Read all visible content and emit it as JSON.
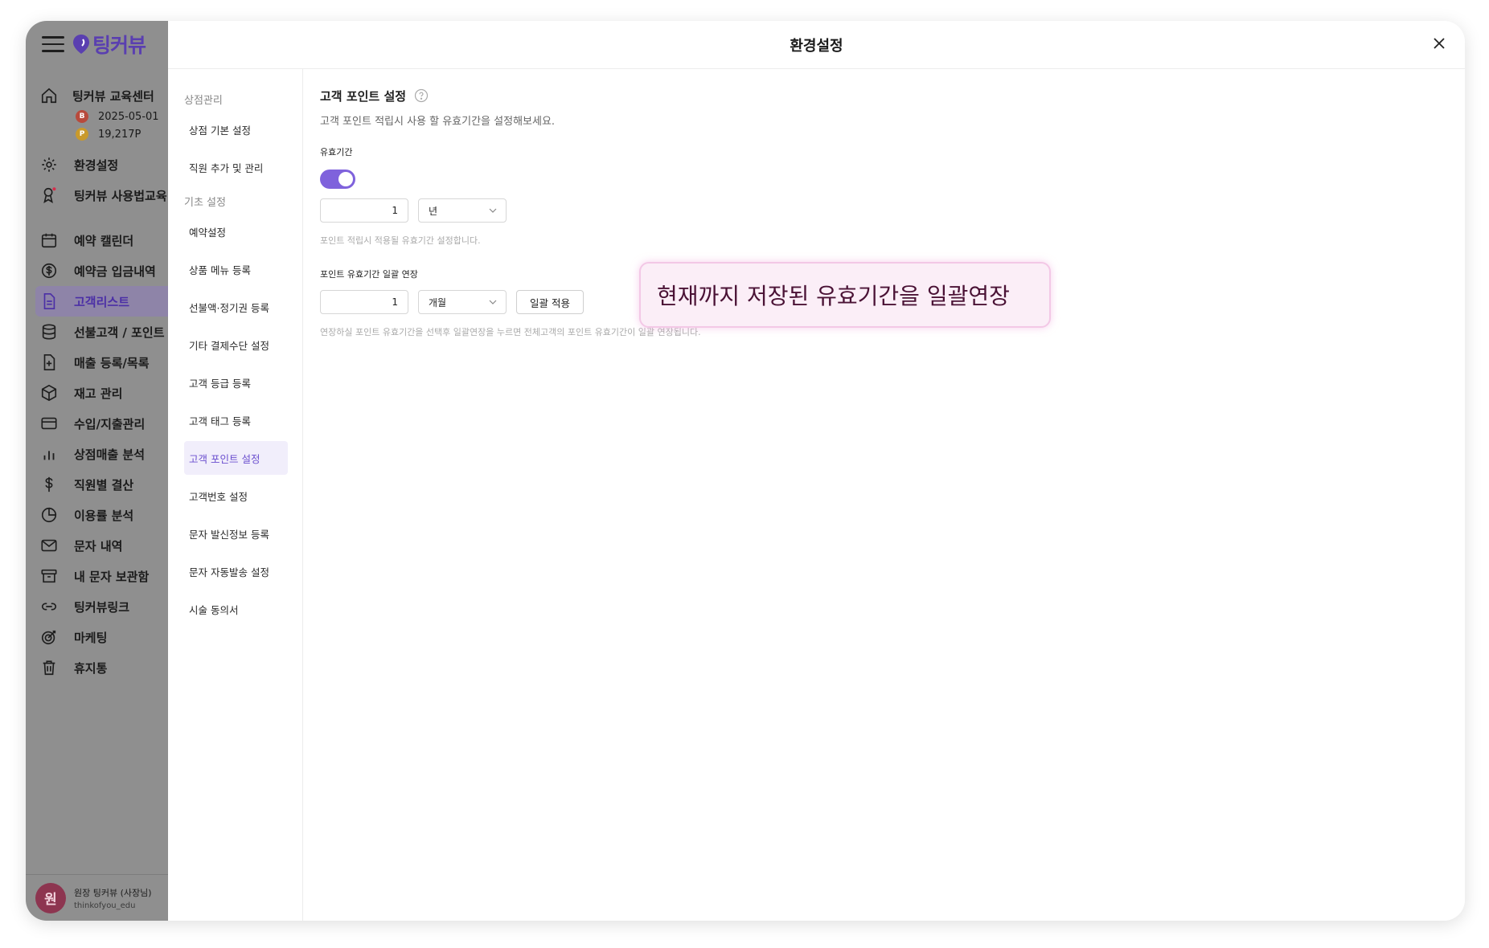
{
  "app": {
    "logo_text": "팅커뷰",
    "store_name": "팅커뷰 교육센터",
    "store_date": "2025-05-01",
    "store_points": "19,217P",
    "menu": [
      {
        "label": "환경설정",
        "icon": "gear-icon"
      },
      {
        "label": "팅커뷰 사용법교육",
        "icon": "award-icon"
      },
      {
        "label": "예약 캘린더",
        "icon": "calendar-icon"
      },
      {
        "label": "예약금 입금내역",
        "icon": "dollar-circle-icon"
      },
      {
        "label": "고객리스트",
        "icon": "document-icon"
      },
      {
        "label": "선불고객 / 포인트",
        "icon": "database-icon"
      },
      {
        "label": "매출 등록/목록",
        "icon": "file-plus-icon"
      },
      {
        "label": "재고 관리",
        "icon": "box-icon"
      },
      {
        "label": "수입/지출관리",
        "icon": "card-icon"
      },
      {
        "label": "상점매출 분석",
        "icon": "bar-chart-icon"
      },
      {
        "label": "직원별 결산",
        "icon": "dollar-icon"
      },
      {
        "label": "이용률 분석",
        "icon": "pie-chart-icon"
      },
      {
        "label": "문자 내역",
        "icon": "mail-icon"
      },
      {
        "label": "내 문자 보관함",
        "icon": "archive-icon"
      },
      {
        "label": "팅커뷰링크",
        "icon": "link-icon"
      },
      {
        "label": "마케팅",
        "icon": "target-icon"
      },
      {
        "label": "휴지통",
        "icon": "trash-icon"
      }
    ],
    "user_avatar": "원",
    "user_name": "원장 팅커뷰 (사장님)",
    "user_id": "thinkofyou_edu"
  },
  "modal": {
    "title": "환경설정",
    "nav_section_1": "상점관리",
    "nav_section_2": "기초 설정",
    "nav_items_1": [
      "상점 기본 설정",
      "직원 추가 및 관리"
    ],
    "nav_items_2": [
      "예약설정",
      "상품 메뉴 등록",
      "선불액·정기권 등록",
      "기타 결제수단 설정",
      "고객 등급 등록",
      "고객 태그 등록",
      "고객 포인트 설정",
      "고객번호 설정",
      "문자 발신정보 등록",
      "문자 자동발송 설정",
      "시술 동의서"
    ],
    "active_nav": "고객 포인트 설정"
  },
  "content": {
    "title": "고객 포인트 설정",
    "description": "고객 포인트 적립시 사용 할 유효기간을 설정해보세요.",
    "validity_label": "유효기간",
    "validity_toggle_on": true,
    "validity_value": "1",
    "validity_unit": "년",
    "validity_hint": "포인트 적립시 적용될 유효기간 설정합니다.",
    "extend_label": "포인트 유효기간 일괄 연장",
    "extend_value": "1",
    "extend_unit": "개월",
    "apply_label": "일괄 적용",
    "extend_hint": "연장하실 포인트 유효기간을 선택후 일괄연장을 누르면 전체고객의 포인트 유효기간이 일괄 연장됩니다."
  },
  "callout": "현재까지 저장된 유효기간을 일괄연장",
  "colors": {
    "accent": "#7f62dc",
    "sidebar_dim": "#8f8f8f",
    "callout_bg": "#fbeef7"
  }
}
